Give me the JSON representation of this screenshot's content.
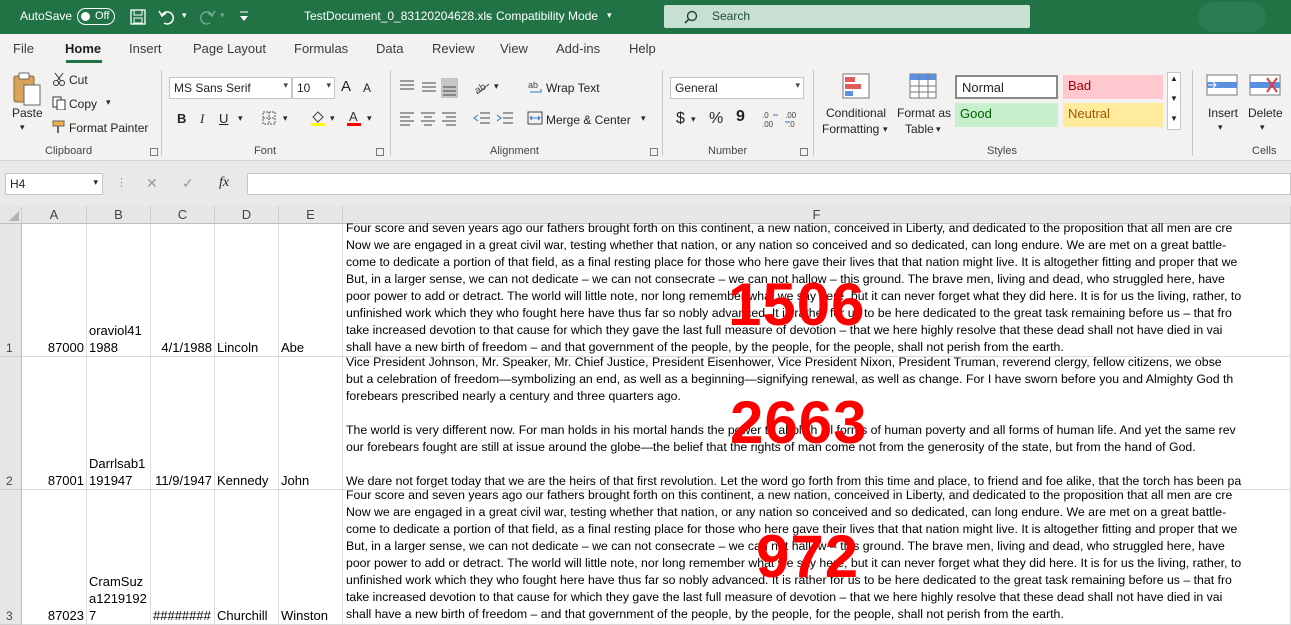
{
  "titlebar": {
    "autosave_label": "AutoSave",
    "autosave_state": "Off",
    "filename": "TestDocument_0_83120204628.xls",
    "sep": "-",
    "mode": "Compatibility Mode",
    "search_placeholder": "Search"
  },
  "menu": [
    "File",
    "Home",
    "Insert",
    "Page Layout",
    "Formulas",
    "Data",
    "Review",
    "View",
    "Add-ins",
    "Help"
  ],
  "clipboard": {
    "paste": "Paste",
    "cut": "Cut",
    "copy": "Copy",
    "format_painter": "Format Painter",
    "label": "Clipboard"
  },
  "font": {
    "name": "MS Sans Serif",
    "size": "10",
    "label": "Font",
    "bold": "B",
    "italic": "I",
    "underline": "U",
    "grow": "A",
    "shrink": "A"
  },
  "alignment": {
    "wrap": "Wrap Text",
    "merge": "Merge & Center",
    "label": "Alignment"
  },
  "number": {
    "format": "General",
    "label": "Number",
    "currency": "$",
    "percent": "%",
    "comma": "9"
  },
  "styles": {
    "conditional_1": "Conditional",
    "conditional_2": "Formatting",
    "format_as_1": "Format as",
    "format_as_2": "Table",
    "normal": "Normal",
    "bad": "Bad",
    "good": "Good",
    "neutral": "Neutral",
    "label": "Styles",
    "normal_color": "#ffffff",
    "bad_color": "#ffc7ce",
    "good_color": "#c6efce",
    "neutral_color": "#ffeb9c"
  },
  "cells": {
    "insert": "Insert",
    "delete": "Delete",
    "label": "Cells"
  },
  "formula_bar": {
    "name_box": "H4",
    "fx": "fx",
    "cancel": "✕",
    "enter": "✓"
  },
  "columns": [
    "A",
    "B",
    "C",
    "D",
    "E",
    "F"
  ],
  "rows": [
    {
      "num": "1",
      "a": "87000",
      "b1": "oraviol41",
      "b2": "1988",
      "c": "4/1/1988",
      "d": "Lincoln",
      "e": "Abe",
      "f": "Four score and seven years ago our fathers brought forth on this continent, a new nation, conceived in Liberty, and dedicated to the proposition that all men are cre\nNow we are engaged in a great civil war, testing whether that nation, or any nation so conceived and so dedicated, can long endure. We are met on a great battle-\ncome to dedicate a portion of that field, as a final resting place for those who here gave their lives that that nation might live. It is altogether fitting and proper that we\nBut, in a larger sense, we can not dedicate – we can not consecrate – we can not hallow – this ground. The brave men, living and dead, who struggled here, have\npoor power to add or detract. The world will little note, nor long remember what we say here, but it can never forget what they did here. It is for us the living, rather, to\nunfinished work which they who fought here have thus far so nobly advanced. It is rather for us to be here dedicated to the great task remaining before us – that fro\ntake increased devotion to that cause for which they gave the last full measure of devotion – that we here highly resolve that these dead shall not have died in vai\nshall have a new birth of freedom – and that government of the people, by the people, for the people, shall not perish from the earth.",
      "overlay": "1506"
    },
    {
      "num": "2",
      "a": "87001",
      "b1": "Darrlsab1",
      "b2": "191947",
      "c": "11/9/1947",
      "d": "Kennedy",
      "e": "John",
      "f": "Vice President Johnson, Mr. Speaker, Mr. Chief Justice, President Eisenhower, Vice President Nixon, President Truman, reverend clergy, fellow citizens, we obse\nbut a celebration of freedom—symbolizing an end, as well as a beginning—signifying renewal, as well as change. For I have sworn before you and Almighty God th\nforebears prescribed nearly a century and three quarters ago.\n\nThe world is very different now. For man holds in his mortal hands the power to abolish all forms of human poverty and all forms of human life. And yet the same rev\nour forebears fought are still at issue around the globe—the belief that the rights of man come not from the generosity of the state, but from the hand of God.\n\nWe dare not forget today that we are the heirs of that first revolution. Let the word go forth from this time and place, to friend and foe alike, that the torch has been pa",
      "overlay": "2663"
    },
    {
      "num": "3",
      "a": "87023",
      "b1": "CramSuz",
      "b2": "a1219192",
      "b3": "7",
      "c": "########",
      "d": "Churchill",
      "e": "Winston",
      "f": "Four score and seven years ago our fathers brought forth on this continent, a new nation, conceived in Liberty, and dedicated to the proposition that all men are cre\nNow we are engaged in a great civil war, testing whether that nation, or any nation so conceived and so dedicated, can long endure. We are met on a great battle-\ncome to dedicate a portion of that field, as a final resting place for those who here gave their lives that that nation might live. It is altogether fitting and proper that we\nBut, in a larger sense, we can not dedicate – we can not consecrate – we can not hallow – this ground. The brave men, living and dead, who struggled here, have\npoor power to add or detract. The world will little note, nor long remember what we say here, but it can never forget what they did here. It is for us the living, rather, to\nunfinished work which they who fought here have thus far so nobly advanced. It is rather for us to be here dedicated to the great task remaining before us – that fro\ntake increased devotion to that cause for which they gave the last full measure of devotion – that we here highly resolve that these dead shall not have died in vai\nshall have a new birth of freedom – and that government of the people, by the people, for the people, shall not perish from the earth.",
      "overlay": "972"
    }
  ]
}
